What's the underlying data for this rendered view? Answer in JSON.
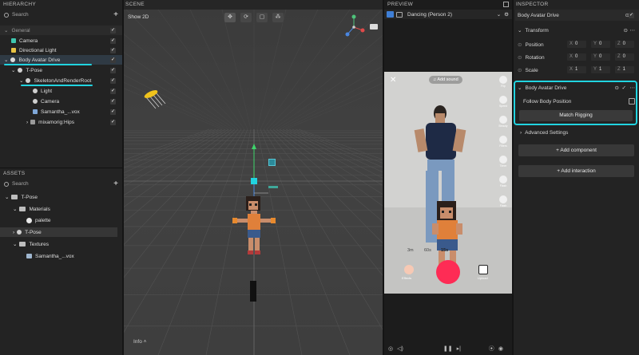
{
  "hierarchy": {
    "title": "HIERARCHY",
    "search_placeholder": "Search",
    "items": [
      {
        "label": "General"
      },
      {
        "label": "Camera"
      },
      {
        "label": "Directional Light"
      },
      {
        "label": "Body Avatar Drive"
      },
      {
        "label": "T-Pose"
      },
      {
        "label": "SkeletonAndRenderRoot"
      },
      {
        "label": "Light"
      },
      {
        "label": "Camera"
      },
      {
        "label": "Samantha_...vox"
      },
      {
        "label": "mixamorig:Hips"
      }
    ]
  },
  "assets": {
    "title": "ASSETS",
    "search_placeholder": "Search",
    "items": [
      {
        "label": "T-Pose"
      },
      {
        "label": "Materials"
      },
      {
        "label": "palette"
      },
      {
        "label": "T-Pose"
      },
      {
        "label": "Textures"
      },
      {
        "label": "Samantha_...vox"
      }
    ]
  },
  "scene": {
    "title": "SCENE",
    "show2d": "Show 2D",
    "info": "Info",
    "tool_icons": [
      "move-icon",
      "rotate-icon",
      "scale-icon",
      "pivot-icon"
    ],
    "axis_y": "Y",
    "axis_x": "X",
    "axis_z": "Z"
  },
  "preview": {
    "title": "PREVIEW",
    "device": "Dancing (Person 2)",
    "add_sound": "Add sound",
    "rail": [
      "Flip",
      "Speed",
      "Beauty",
      "Filters",
      "Timer",
      "Flash",
      "Flash"
    ],
    "timer_options": [
      "3m",
      "60s",
      "15s"
    ],
    "effects": "Effects",
    "upload": "Upload"
  },
  "inspector": {
    "title": "INSPECTOR",
    "object_name": "Body Avatar Drive",
    "transform": {
      "label": "Transform",
      "position": {
        "label": "Position",
        "x": "0",
        "y": "0",
        "z": "0"
      },
      "rotation": {
        "label": "Rotation",
        "x": "0",
        "y": "0",
        "z": "0"
      },
      "scale": {
        "label": "Scale",
        "x": "1",
        "y": "1",
        "z": "1"
      }
    },
    "component": {
      "label": "Body Avatar Drive",
      "follow_body_position": "Follow Body Position",
      "match_rigging": "Match Rigging",
      "advanced_settings": "Advanced Settings"
    },
    "add_component": "+ Add component",
    "add_interaction": "+ Add interaction"
  },
  "colors": {
    "accent_cyan": "#21d4e0",
    "selected_row": "#2f3a44",
    "record_red": "#fe2c55"
  }
}
